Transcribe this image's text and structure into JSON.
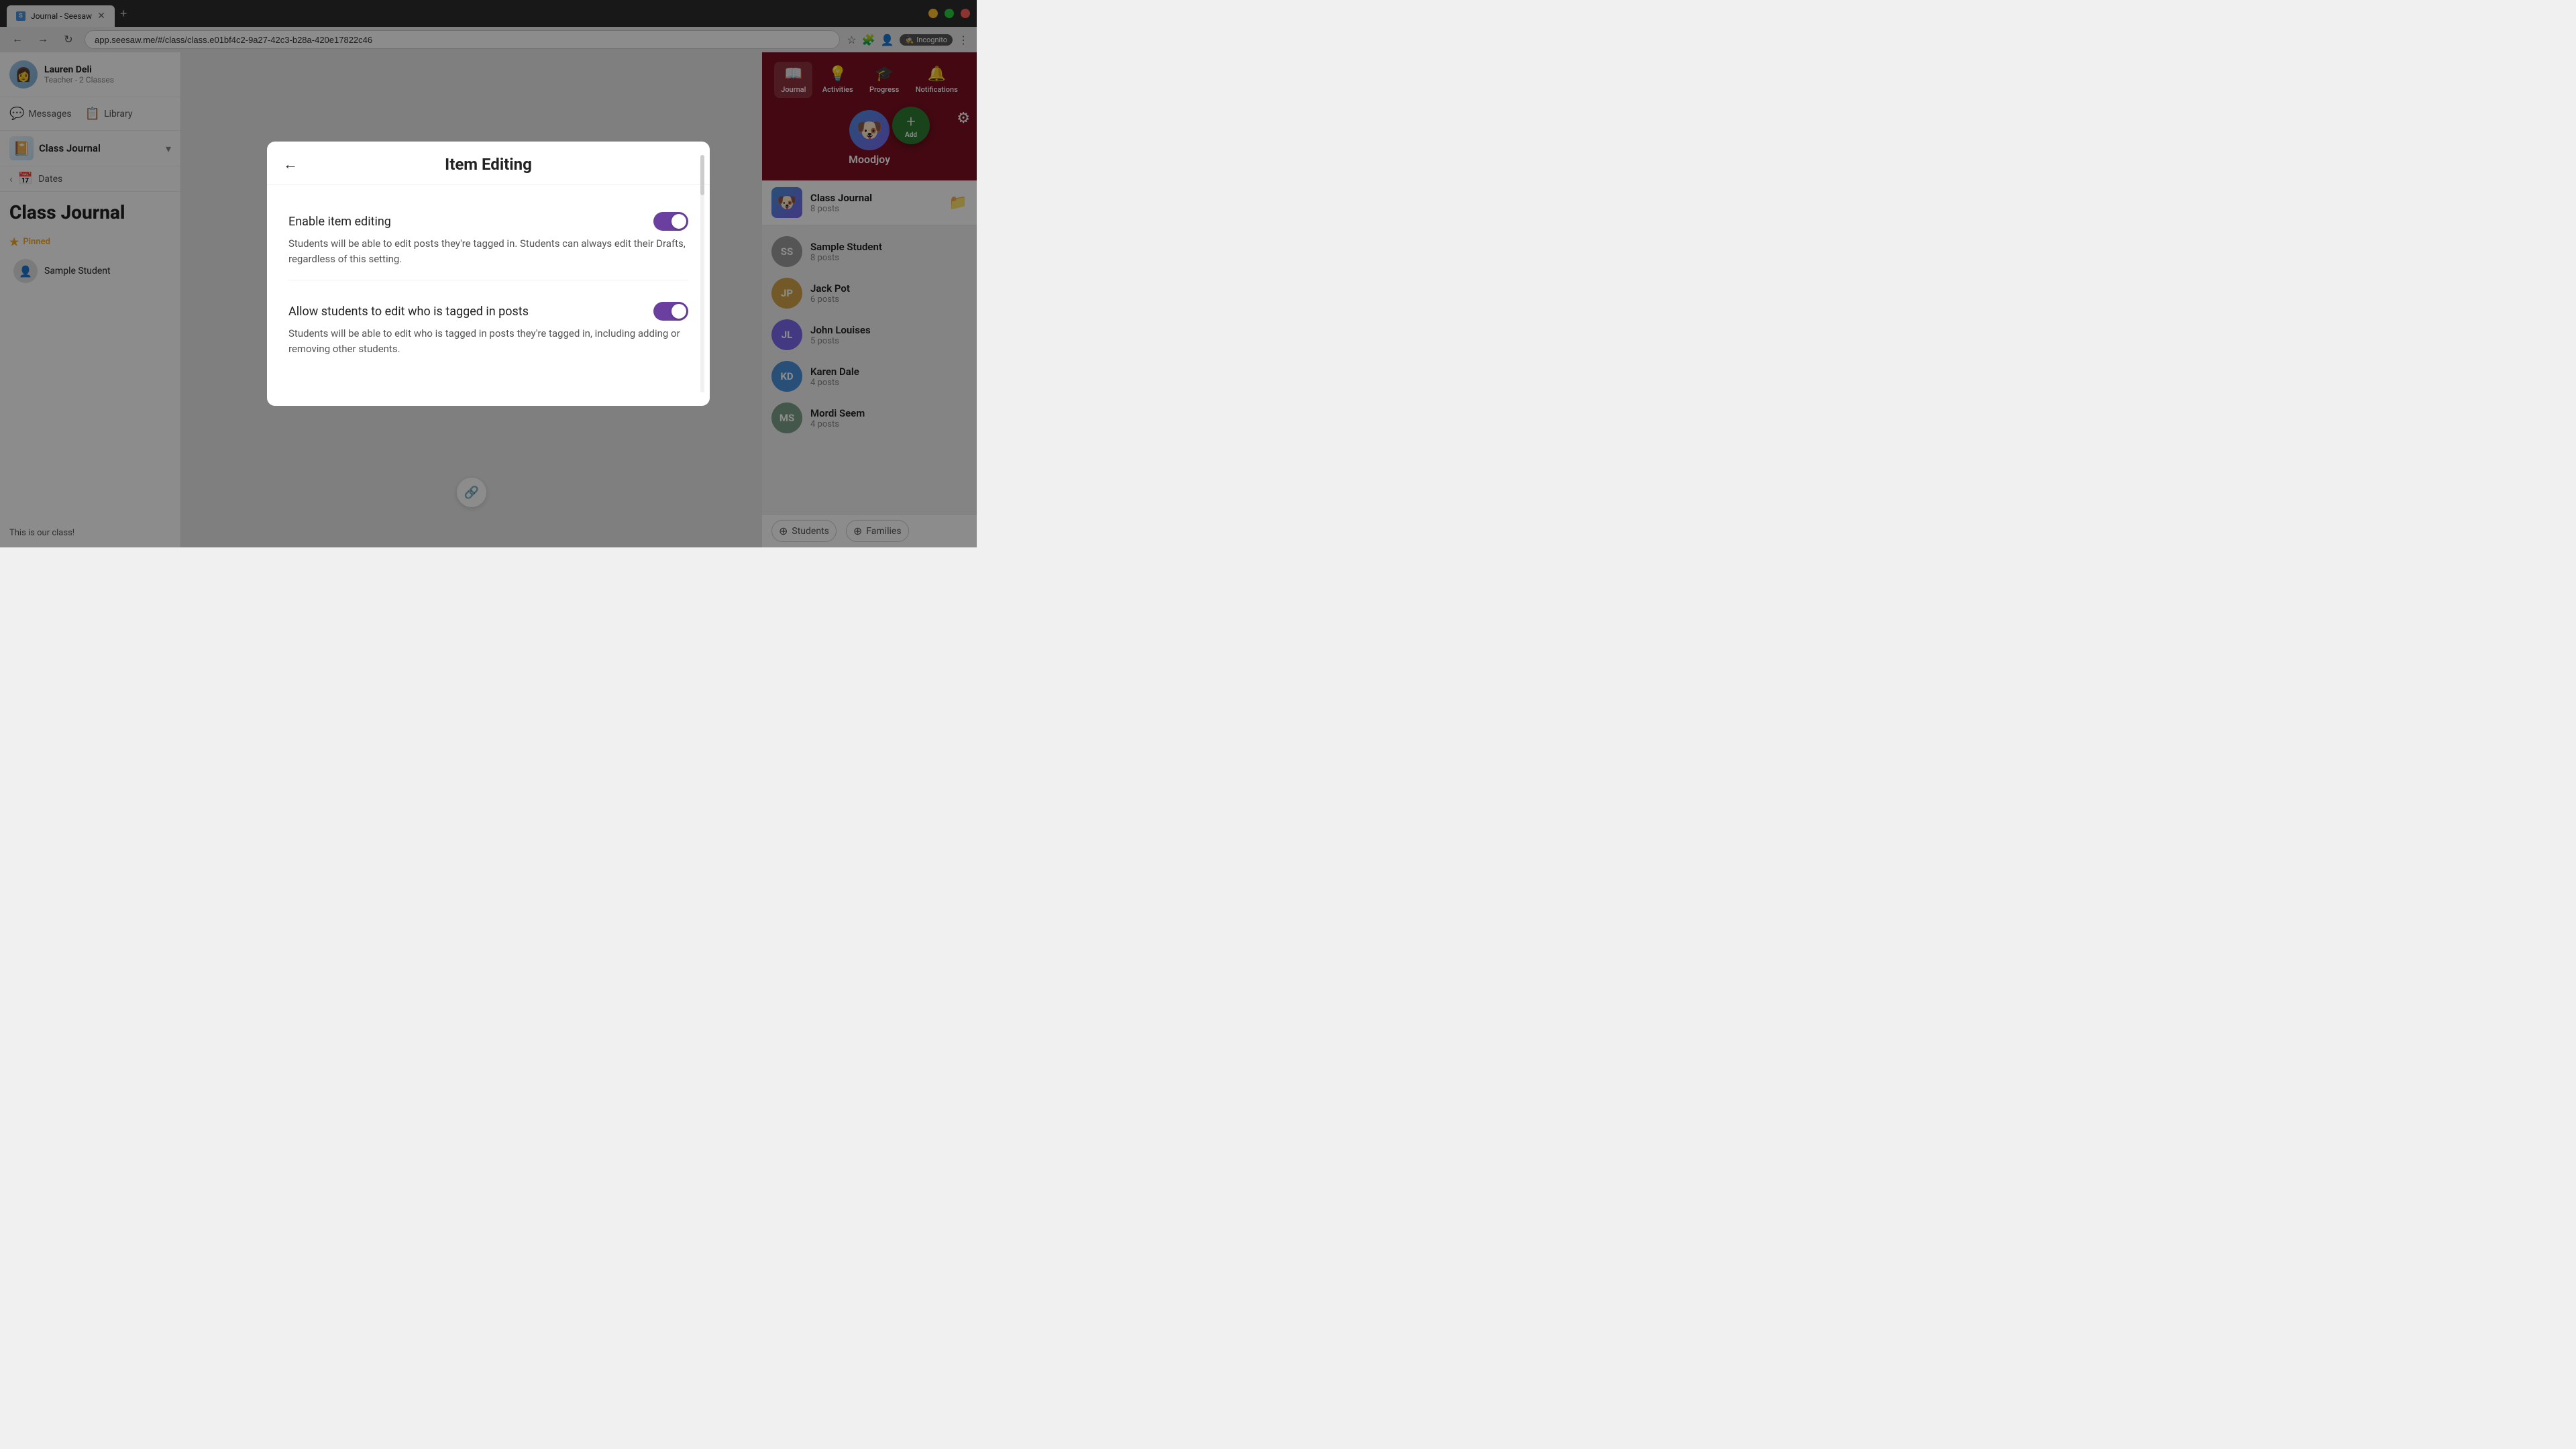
{
  "browser": {
    "tab_label": "Journal - Seesaw",
    "url": "app.seesaw.me/#/class/class.e01bf4c2-9a27-42c3-b28a-420e17822c46",
    "incognito_label": "Incognito"
  },
  "user": {
    "name": "Lauren Deli",
    "role": "Teacher - 2 Classes"
  },
  "nav": {
    "messages_label": "Messages",
    "library_label": "Library"
  },
  "class": {
    "name": "Class Journal",
    "date_label": "Dates"
  },
  "pinned": {
    "label": "Pinned",
    "student_name": "Sample Student"
  },
  "tagline": "This is our class!",
  "right_nav": {
    "journal_label": "Journal",
    "activities_label": "Activities",
    "progress_label": "Progress",
    "notifications_label": "Notifications"
  },
  "moodjoy": {
    "name": "Moodjoy"
  },
  "add_button": {
    "label": "Add"
  },
  "class_journal_entry": {
    "name": "Class Journal",
    "posts": "8 posts"
  },
  "students": [
    {
      "name": "Sample Student",
      "posts": "8 posts",
      "initials": "SS",
      "color": "#9c9c9c"
    },
    {
      "name": "Jack Pot",
      "posts": "6 posts",
      "initials": "JP",
      "color": "#d4a24a"
    },
    {
      "name": "John Louises",
      "posts": "5 posts",
      "initials": "JL",
      "color": "#7b68ee"
    },
    {
      "name": "Karen Dale",
      "posts": "4 posts",
      "initials": "KD",
      "color": "#4a90d9"
    },
    {
      "name": "Mordi Seem",
      "posts": "4 posts",
      "initials": "MS",
      "color": "#7b9e87"
    }
  ],
  "bottom_bar": {
    "students_label": "Students",
    "families_label": "Families"
  },
  "modal": {
    "title": "Item Editing",
    "back_aria": "back",
    "setting1": {
      "label": "Enable item editing",
      "enabled": true,
      "description": "Students will be able to edit posts they're tagged in. Students can always edit their Drafts, regardless of this setting."
    },
    "setting2": {
      "label": "Allow students to edit who is tagged in posts",
      "enabled": true,
      "description": "Students will be able to edit who is tagged in posts they're tagged in, including adding or removing other students."
    }
  },
  "page": {
    "title": "Class Journal"
  }
}
